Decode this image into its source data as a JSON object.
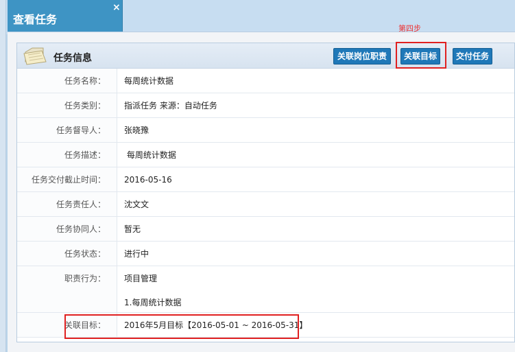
{
  "tab": {
    "title": "查看任务",
    "close_symbol": "×"
  },
  "annotation": {
    "step": "第四步"
  },
  "card": {
    "title": "任务信息",
    "buttons": {
      "duty": "关联岗位职责",
      "goal": "关联目标",
      "submit": "交付任务"
    }
  },
  "fields": [
    {
      "label": "任务名称：",
      "value": "每周统计数据"
    },
    {
      "label": "任务类别：",
      "value": "指派任务 来源：自动任务"
    },
    {
      "label": "任务督导人：",
      "value": "张晓豫"
    },
    {
      "label": "任务描述：",
      "value": " 每周统计数据"
    },
    {
      "label": "任务交付截止时间：",
      "value": "2016-05-16"
    },
    {
      "label": "任务责任人：",
      "value": "沈文文"
    },
    {
      "label": "任务协同人：",
      "value": "暂无"
    },
    {
      "label": "任务状态：",
      "value": "进行中"
    }
  ],
  "duty": {
    "label": "职责行为：",
    "value": "项目管理",
    "item": "1.每周统计数据"
  },
  "goal": {
    "label": "关联目标：",
    "value": "2016年5月目标【2016-05-01 ~ 2016-05-31】"
  },
  "colors": {
    "accent": "#1f78b8",
    "highlight": "#e02020",
    "tab": "#3e94c4"
  }
}
